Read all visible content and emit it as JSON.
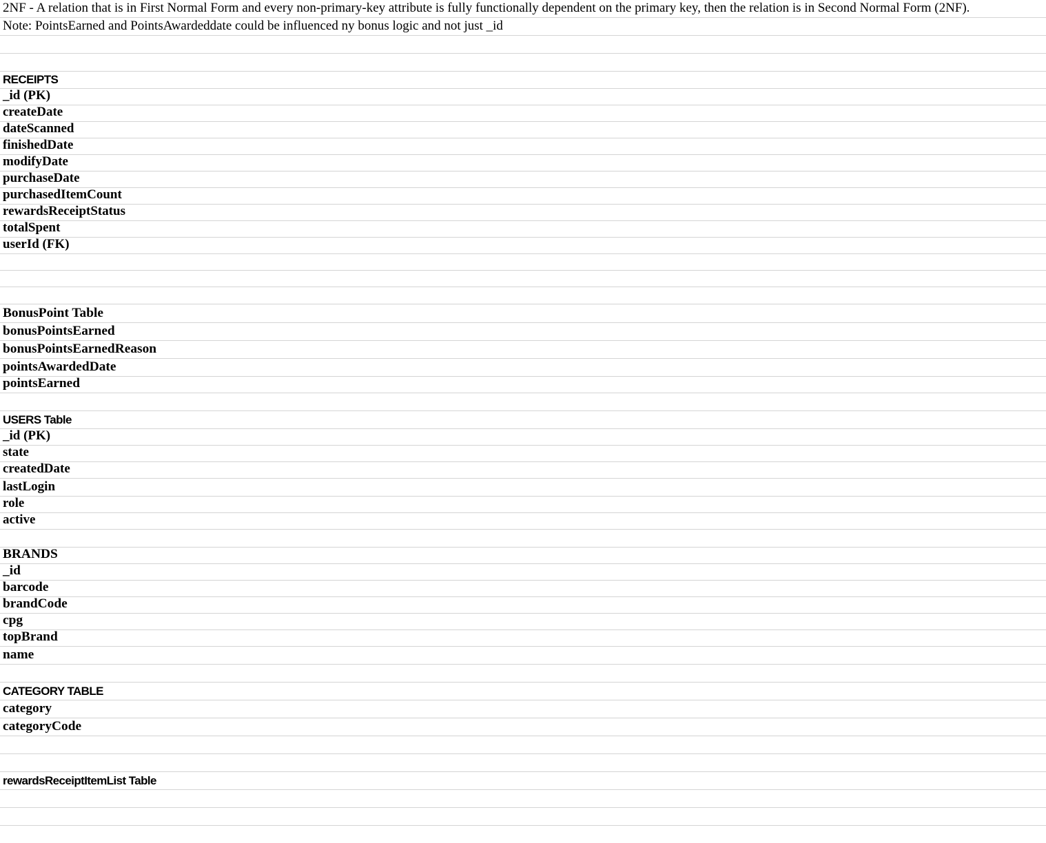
{
  "sheet": {
    "intro": "2NF - A relation that is in First Normal Form and every non-primary-key attribute is fully functionally dependent on the primary key, then the relation is in Second Normal Form (2NF).",
    "note": "Note: PointsEarned and PointsAwardeddate could be influenced ny bonus logic and not just _id"
  },
  "receipts": {
    "header": "RECEIPTS",
    "fields": [
      "_id (PK)",
      "createDate",
      "dateScanned",
      "finishedDate",
      "modifyDate",
      "purchaseDate",
      "purchasedItemCount",
      "rewardsReceiptStatus",
      "totalSpent",
      "userId (FK)"
    ]
  },
  "bonus_point": {
    "header": "BonusPoint Table",
    "fields": [
      "bonusPointsEarned",
      "bonusPointsEarnedReason",
      "pointsAwardedDate",
      "pointsEarned"
    ]
  },
  "users": {
    "header": "USERS Table",
    "fields": [
      "_id (PK)",
      "state",
      "createdDate",
      "lastLogin",
      "role",
      "active"
    ]
  },
  "brands": {
    "header": "BRANDS",
    "fields": [
      "_id",
      "barcode",
      "brandCode",
      "cpg",
      "topBrand",
      "name"
    ]
  },
  "category": {
    "header": "CATEGORY TABLE",
    "fields": [
      "category",
      "categoryCode"
    ]
  },
  "rewards_item_list": {
    "header": "rewardsReceiptItemList Table"
  }
}
